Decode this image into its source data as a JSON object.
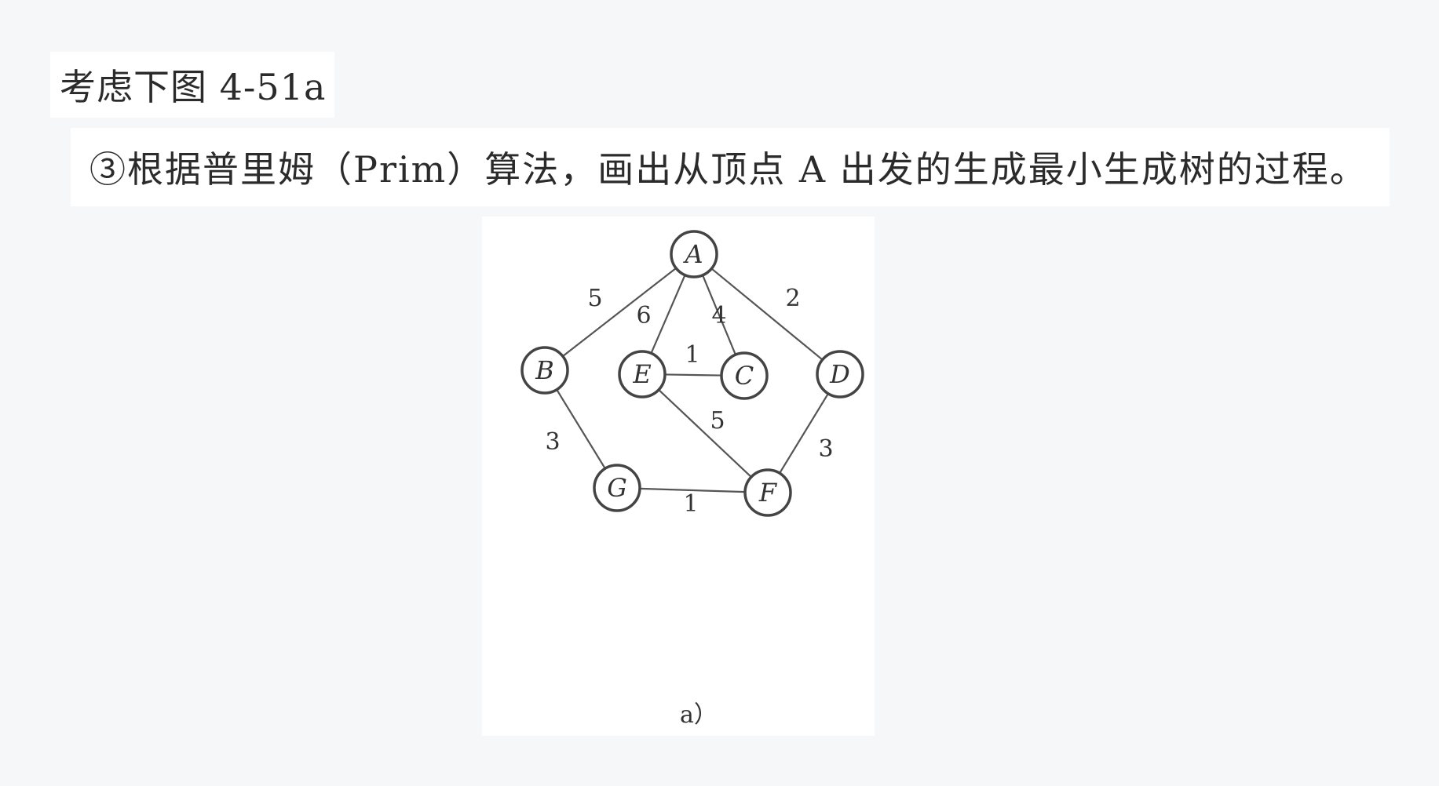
{
  "heading": "考虑下图 4-51a",
  "question": "③根据普里姆（Prim）算法，画出从顶点 A 出发的生成最小生成树的过程。",
  "figure": {
    "caption": "a）",
    "vertices": [
      {
        "id": "A",
        "label": "A"
      },
      {
        "id": "B",
        "label": "B"
      },
      {
        "id": "E",
        "label": "E"
      },
      {
        "id": "C",
        "label": "C"
      },
      {
        "id": "D",
        "label": "D"
      },
      {
        "id": "G",
        "label": "G"
      },
      {
        "id": "F",
        "label": "F"
      }
    ],
    "edges": [
      {
        "from": "A",
        "to": "B",
        "weight": "5"
      },
      {
        "from": "A",
        "to": "E",
        "weight": "6"
      },
      {
        "from": "A",
        "to": "C",
        "weight": "4"
      },
      {
        "from": "A",
        "to": "D",
        "weight": "2"
      },
      {
        "from": "E",
        "to": "C",
        "weight": "1"
      },
      {
        "from": "B",
        "to": "G",
        "weight": "3"
      },
      {
        "from": "E",
        "to": "F",
        "weight": "5"
      },
      {
        "from": "D",
        "to": "F",
        "weight": "3"
      },
      {
        "from": "G",
        "to": "F",
        "weight": "1"
      }
    ]
  }
}
